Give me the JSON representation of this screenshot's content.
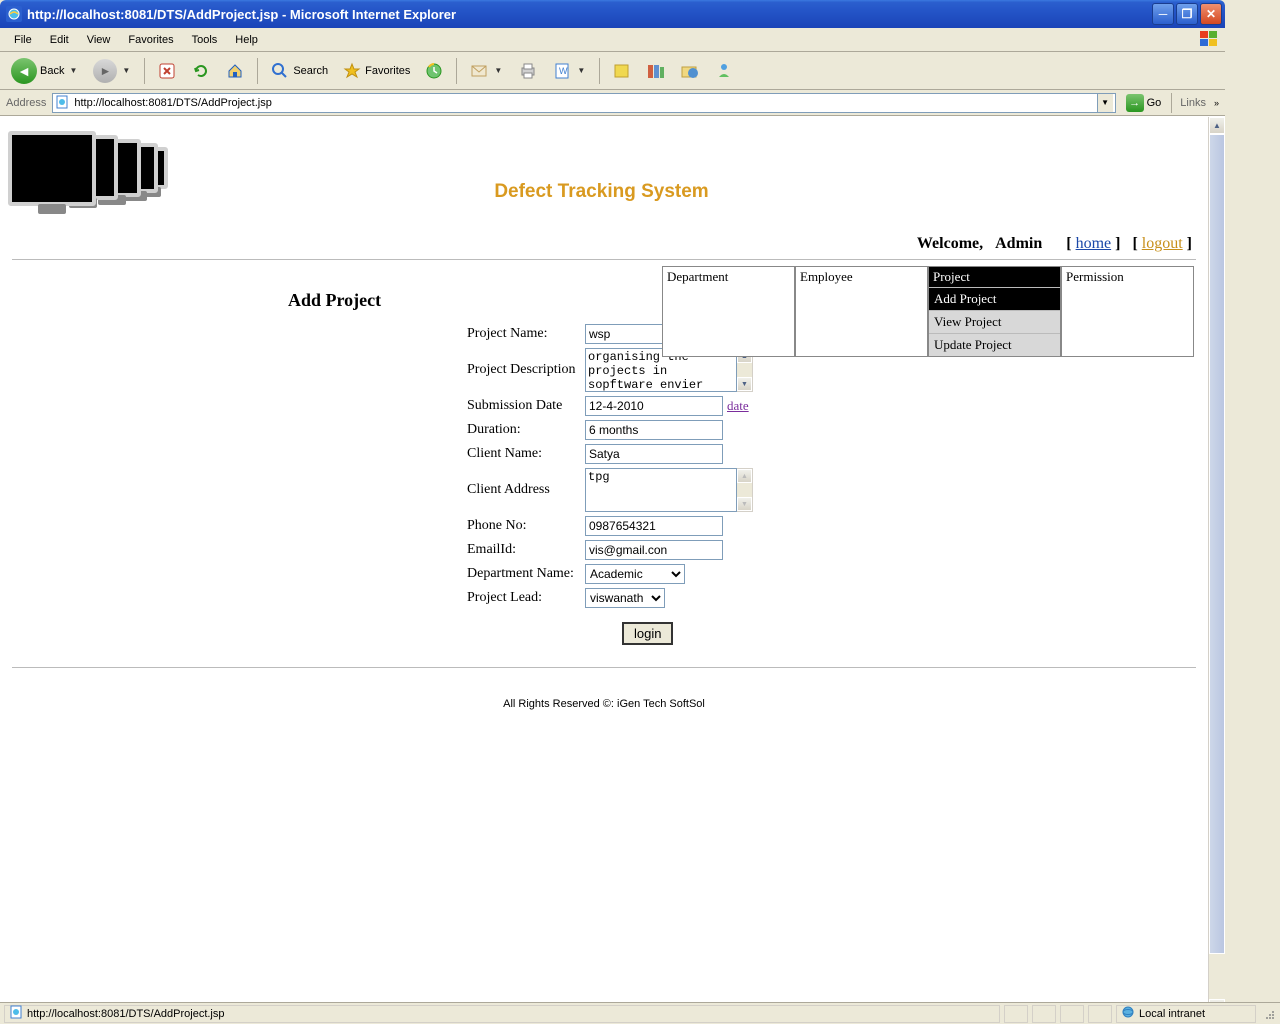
{
  "window": {
    "title": "http://localhost:8081/DTS/AddProject.jsp - Microsoft Internet Explorer"
  },
  "menu": {
    "file": "File",
    "edit": "Edit",
    "view": "View",
    "favorites": "Favorites",
    "tools": "Tools",
    "help": "Help"
  },
  "toolbar": {
    "back": "Back",
    "search": "Search",
    "favorites": "Favorites"
  },
  "addressbar": {
    "label": "Address",
    "url": "http://localhost:8081/DTS/AddProject.jsp",
    "go": "Go",
    "links": "Links"
  },
  "page": {
    "app_title": "Defect Tracking System",
    "welcome": "Welcome,",
    "user": "Admin",
    "home": "home",
    "logout": "logout",
    "section": "Add Project",
    "footer": "All Rights Reserved ©: iGen Tech SoftSol"
  },
  "nav": {
    "department": "Department",
    "employee": "Employee",
    "project": "Project",
    "permission": "Permission",
    "sub": {
      "add": "Add Project",
      "view": "View Project",
      "update": "Update Project"
    }
  },
  "form": {
    "labels": {
      "project_name": "Project Name:",
      "description": "Project Description",
      "submission_date": "Submission Date",
      "duration": "Duration:",
      "client_name": "Client Name:",
      "client_address": "Client Address",
      "phone": "Phone No:",
      "email": "EmailId:",
      "department": "Department Name:",
      "lead": "Project Lead:"
    },
    "values": {
      "project_name": "wsp",
      "description": "organising the projects in sopftware envier",
      "submission_date": "12-4-2010",
      "duration": "6 months",
      "client_name": "Satya",
      "client_address": "tpg",
      "phone": "0987654321",
      "email": "vis@gmail.con",
      "department": "Academic",
      "lead": "viswanath"
    },
    "date_link": "date",
    "submit": "login"
  },
  "statusbar": {
    "text": "http://localhost:8081/DTS/AddProject.jsp",
    "zone": "Local intranet"
  }
}
